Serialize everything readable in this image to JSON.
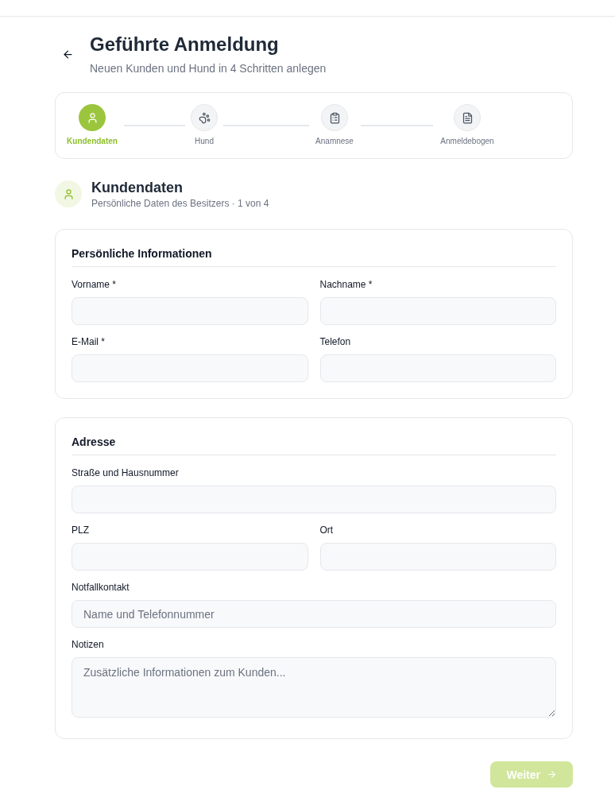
{
  "header": {
    "title": "Geführte Anmeldung",
    "subtitle": "Neuen Kunden und Hund in 4 Schritten anlegen"
  },
  "steps": [
    {
      "label": "Kundendaten",
      "selected": true
    },
    {
      "label": "Hund",
      "selected": false
    },
    {
      "label": "Anamnese",
      "selected": false
    },
    {
      "label": "Anmeldebogen",
      "selected": false
    }
  ],
  "section": {
    "title": "Kundendaten",
    "subtitle": "Persönliche Daten des Besitzers · 1 von 4"
  },
  "cards": [
    {
      "title": "Persönliche Informationen",
      "rows": [
        [
          {
            "label": "Vorname *",
            "kind": "input"
          },
          {
            "label": "Nachname *",
            "kind": "input"
          }
        ],
        [
          {
            "label": "E-Mail *",
            "kind": "input"
          },
          {
            "label": "Telefon",
            "kind": "input"
          }
        ]
      ]
    },
    {
      "title": "Adresse",
      "rows": [
        [
          {
            "label": "Straße und Hausnummer",
            "kind": "input"
          }
        ],
        [
          {
            "label": "PLZ",
            "kind": "input"
          },
          {
            "label": "Ort",
            "kind": "input"
          }
        ],
        [
          {
            "label": "Notfallkontakt",
            "kind": "input",
            "placeholder": "Name und Telefonnummer"
          }
        ],
        [
          {
            "label": "Notizen",
            "kind": "textarea",
            "placeholder": "Zusätzliche Informationen zum Kunden..."
          }
        ]
      ]
    }
  ],
  "next_button": {
    "label": "Weiter",
    "disabled": true
  }
}
